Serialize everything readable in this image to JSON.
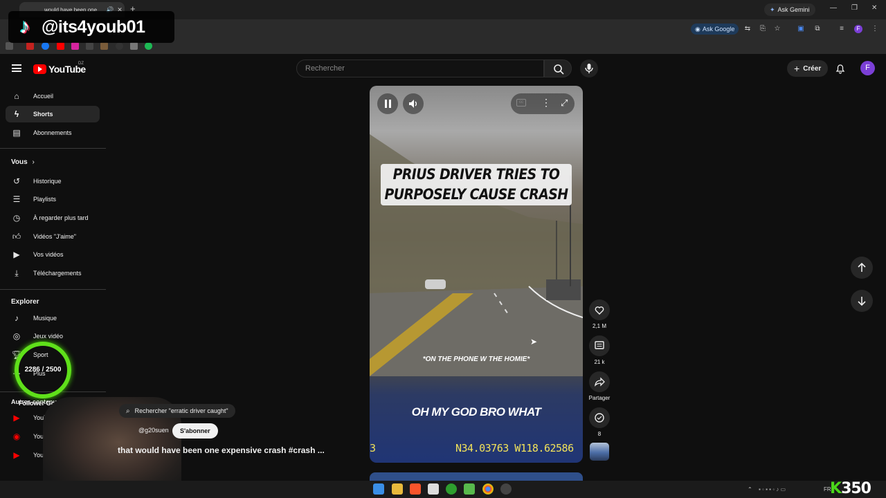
{
  "browser": {
    "tab_title": "would have been one",
    "ask_gemini": "Ask Gemini",
    "ask_google": "Ask Google"
  },
  "watermark": {
    "handle": "@its4youb01"
  },
  "youtube": {
    "logo_text": "YouTube",
    "country_code": "DZ",
    "search_placeholder": "Rechercher",
    "create_label": "Créer",
    "avatar_letter": "F"
  },
  "sidebar": {
    "main": [
      {
        "label": "Accueil",
        "icon": "home-icon"
      },
      {
        "label": "Shorts",
        "icon": "shorts-icon"
      },
      {
        "label": "Abonnements",
        "icon": "subscriptions-icon"
      }
    ],
    "you_header": "Vous",
    "you": [
      {
        "label": "Historique",
        "icon": "history-icon"
      },
      {
        "label": "Playlists",
        "icon": "playlists-icon"
      },
      {
        "label": "À regarder plus tard",
        "icon": "watch-later-icon"
      },
      {
        "label": "Vidéos \"J'aime\"",
        "icon": "like-icon"
      },
      {
        "label": "Vos vidéos",
        "icon": "your-videos-icon"
      },
      {
        "label": "Téléchargements",
        "icon": "downloads-icon"
      }
    ],
    "explore_header": "Explorer",
    "explore": [
      {
        "label": "Musique",
        "icon": "music-icon"
      },
      {
        "label": "Jeux vidéo",
        "icon": "gaming-icon"
      },
      {
        "label": "Sport",
        "icon": "trophy-icon"
      },
      {
        "label": "Plus",
        "icon": "more-icon"
      }
    ],
    "other_header": "Autres contenus YouT",
    "other": [
      {
        "label": "YouTube Prem",
        "icon": "youtube-premium-icon"
      },
      {
        "label": "YouTube Mu",
        "icon": "youtube-music-icon"
      },
      {
        "label": "YouTube Kids",
        "icon": "youtube-kids-icon"
      }
    ]
  },
  "follower_goal": {
    "label": "Follower Goal",
    "value": "2286 / 2500",
    "current": 2286,
    "target": 2500
  },
  "video": {
    "title_line1": "PRIUS DRIVER TRIES TO",
    "title_line2": "PURPOSELY CAUSE CRASH",
    "subtitle_small": "*ON THE PHONE W THE HOMIE*",
    "subtitle_big": "OH MY GOD BRO WHAT",
    "gps_left": "3",
    "gps": "N34.03763 W118.62586"
  },
  "actions": {
    "likes": "2,1 M",
    "comments": "21 k",
    "share": "Partager",
    "remix": "8"
  },
  "overlay": {
    "search_chip": "Rechercher \"erratic driver caught\"",
    "channel": "@g20suen",
    "subscribe": "S'abonner",
    "video_title": "that would have been one expensive crash #crash ..."
  },
  "taskbar": {
    "overlay_counter": "350",
    "language": "FR"
  }
}
